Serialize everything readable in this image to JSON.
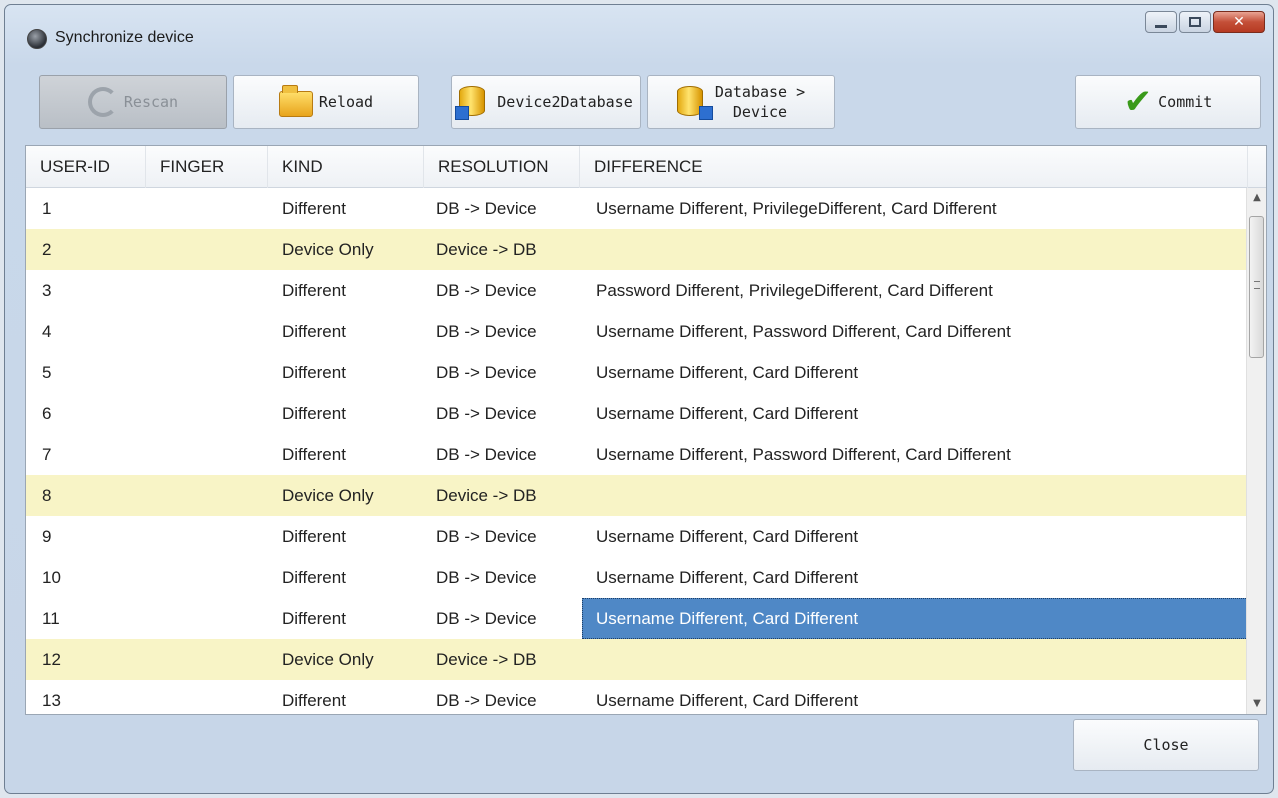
{
  "window": {
    "title": "Synchronize device"
  },
  "toolbar": {
    "rescan_label": "Rescan",
    "reload_label": "Reload",
    "device2database_label": "Device2Database",
    "database_device_line1": "Database >",
    "database_device_line2": "Device",
    "commit_label": "Commit"
  },
  "table": {
    "columns": [
      "USER-ID",
      "FINGER",
      "KIND",
      "RESOLUTION",
      "DIFFERENCE"
    ],
    "rows": [
      {
        "id": "1",
        "finger": "",
        "kind": "Different",
        "resolution": "DB -> Device",
        "difference": "Username Different, PrivilegeDifferent, Card Different"
      },
      {
        "id": "2",
        "finger": "",
        "kind": "Device Only",
        "resolution": "Device -> DB",
        "difference": ""
      },
      {
        "id": "3",
        "finger": "",
        "kind": "Different",
        "resolution": "DB -> Device",
        "difference": "Password Different, PrivilegeDifferent, Card Different"
      },
      {
        "id": "4",
        "finger": "",
        "kind": "Different",
        "resolution": "DB -> Device",
        "difference": "Username Different, Password Different, Card Different"
      },
      {
        "id": "5",
        "finger": "",
        "kind": "Different",
        "resolution": "DB -> Device",
        "difference": "Username Different, Card Different"
      },
      {
        "id": "6",
        "finger": "",
        "kind": "Different",
        "resolution": "DB -> Device",
        "difference": "Username Different, Card Different"
      },
      {
        "id": "7",
        "finger": "",
        "kind": "Different",
        "resolution": "DB -> Device",
        "difference": "Username Different, Password Different, Card Different"
      },
      {
        "id": "8",
        "finger": "",
        "kind": "Device Only",
        "resolution": "Device -> DB",
        "difference": ""
      },
      {
        "id": "9",
        "finger": "",
        "kind": "Different",
        "resolution": "DB -> Device",
        "difference": "Username Different, Card Different"
      },
      {
        "id": "10",
        "finger": "",
        "kind": "Different",
        "resolution": "DB -> Device",
        "difference": "Username Different, Card Different"
      },
      {
        "id": "11",
        "finger": "",
        "kind": "Different",
        "resolution": "DB -> Device",
        "difference": "Username Different, Card Different"
      },
      {
        "id": "12",
        "finger": "",
        "kind": "Device Only",
        "resolution": "Device -> DB",
        "difference": ""
      },
      {
        "id": "13",
        "finger": "",
        "kind": "Different",
        "resolution": "DB -> Device",
        "difference": "Username Different, Card Different"
      }
    ],
    "selected_row": "11",
    "highlight_kind": "Device Only"
  },
  "footer": {
    "close_label": "Close"
  },
  "colors": {
    "row_highlight": "#f8f4c6",
    "selection": "#4f88c6",
    "close_button": "#c44f38"
  },
  "icons": [
    "app-icon",
    "minimize-icon",
    "maximize-icon",
    "close-icon",
    "refresh-icon",
    "folder-icon",
    "database-icon",
    "checkmark-icon",
    "scroll-up-icon",
    "scroll-down-icon"
  ]
}
